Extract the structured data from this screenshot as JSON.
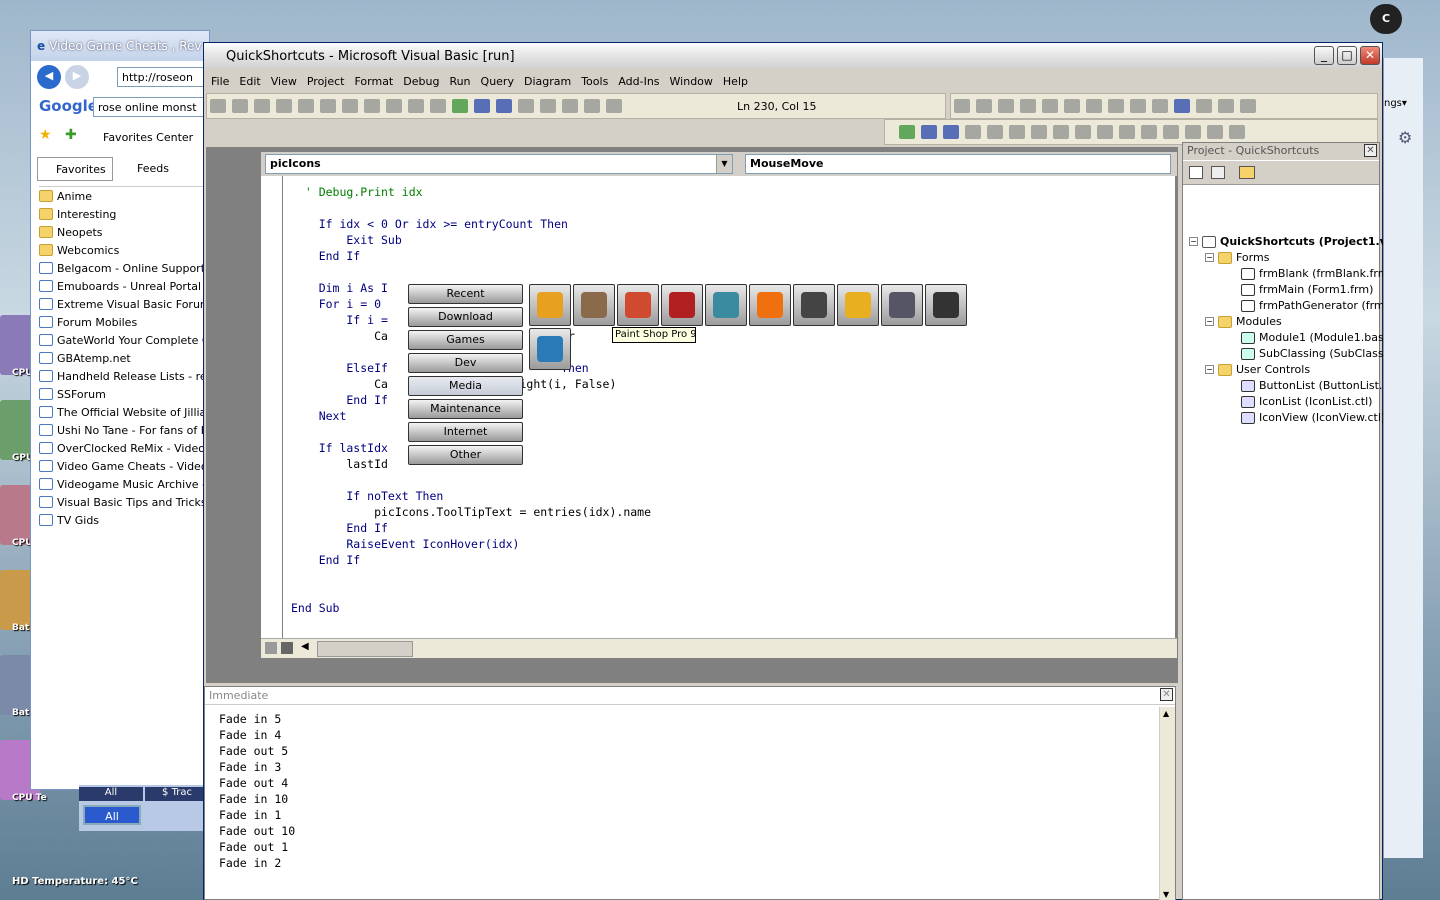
{
  "desktop": {
    "gadgets": [
      "CPU",
      "GPU",
      "CPU",
      "Bat",
      "Bat",
      "CPU Te"
    ],
    "hd_temperature": "HD Temperature: 45°C"
  },
  "ie": {
    "title": "Video Game Cheats , Rev",
    "address": "http://roseon",
    "google_search": "rose online monst",
    "favorites_center": "Favorites Center",
    "tab_favorites": "Favorites",
    "tab_feeds": "Feeds",
    "favorites": [
      {
        "label": "Anime",
        "type": "folder"
      },
      {
        "label": "Interesting",
        "type": "folder"
      },
      {
        "label": "Neopets",
        "type": "folder"
      },
      {
        "label": "Webcomics",
        "type": "folder"
      },
      {
        "label": "Belgacom - Online Support",
        "type": "page"
      },
      {
        "label": "Emuboards - Unreal Portal",
        "type": "page"
      },
      {
        "label": "Extreme Visual Basic Forum -",
        "type": "page"
      },
      {
        "label": "Forum Mobiles",
        "type": "page"
      },
      {
        "label": "GateWorld  Your Complete G",
        "type": "page"
      },
      {
        "label": "GBAtemp.net",
        "type": "page"
      },
      {
        "label": "Handheld Release Lists - rele",
        "type": "page"
      },
      {
        "label": "SSForum",
        "type": "page"
      },
      {
        "label": "The Official Website of Jillian",
        "type": "page"
      },
      {
        "label": "Ushi No Tane - For fans of H",
        "type": "page"
      },
      {
        "label": "OverClocked ReMix - Video G",
        "type": "page"
      },
      {
        "label": "Video Game Cheats - Video G",
        "type": "page"
      },
      {
        "label": "Videogame Music Archive - 1",
        "type": "page"
      },
      {
        "label": "Visual Basic Tips and Tricks",
        "type": "page"
      },
      {
        "label": "TV Gids",
        "type": "page"
      }
    ],
    "bottom_all_1": "All",
    "bottom_tab2": "$ Trac",
    "bottom_all_2": "All"
  },
  "vb": {
    "title": "QuickShortcuts - Microsoft Visual Basic [run]",
    "menus": [
      "File",
      "Edit",
      "View",
      "Project",
      "Format",
      "Debug",
      "Run",
      "Query",
      "Diagram",
      "Tools",
      "Add-Ins",
      "Window",
      "Help"
    ],
    "status": "Ln 230, Col 15",
    "object_combo": "picIcons",
    "proc_combo": "MouseMove",
    "code_lines": [
      {
        "t": "  ' Debug.Print idx",
        "c": "cm"
      },
      {
        "t": "",
        "c": ""
      },
      {
        "t": "    If idx < 0 Or idx >= entryCount Then",
        "c": "kw"
      },
      {
        "t": "        Exit Sub",
        "c": "kw"
      },
      {
        "t": "    End If",
        "c": "kw"
      },
      {
        "t": "",
        "c": ""
      },
      {
        "t": "    Dim i As I",
        "c": "kw"
      },
      {
        "t": "    For i = 0",
        "c": "kw"
      },
      {
        "t": "        If i =",
        "c": "kw"
      },
      {
        "t": "            Ca                     (i, Tr",
        "c": ""
      },
      {
        "t": "",
        "c": ""
      },
      {
        "t": "        ElseIf                         Then",
        "c": "kw"
      },
      {
        "t": "            Ca                  light(i, False)",
        "c": ""
      },
      {
        "t": "        End If",
        "c": "kw"
      },
      {
        "t": "    Next",
        "c": "kw"
      },
      {
        "t": "",
        "c": ""
      },
      {
        "t": "    If lastIdx",
        "c": "kw"
      },
      {
        "t": "        lastId",
        "c": ""
      },
      {
        "t": "",
        "c": ""
      },
      {
        "t": "        If noText Then",
        "c": "kw"
      },
      {
        "t": "            picIcons.ToolTipText = entries(idx).name",
        "c": ""
      },
      {
        "t": "        End If",
        "c": "kw"
      },
      {
        "t": "        RaiseEvent IconHover(idx)",
        "c": "kw"
      },
      {
        "t": "    End If",
        "c": "kw"
      },
      {
        "t": "",
        "c": ""
      },
      {
        "t": "",
        "c": ""
      },
      {
        "t": "End Sub",
        "c": "kw"
      }
    ],
    "immediate_title": "Immediate",
    "immediate_lines": [
      "Fade in 5",
      "Fade in 4",
      "Fade out 5",
      "Fade in 3",
      "Fade out 4",
      "Fade in 10",
      "Fade in 1",
      "Fade out 10",
      "Fade out 1",
      "Fade in 2"
    ],
    "project_title": "Project - QuickShortcuts",
    "tree": {
      "root": "QuickShortcuts (Project1.v",
      "forms_label": "Forms",
      "forms": [
        "frmBlank (frmBlank.frm)",
        "frmMain (Form1.frm)",
        "frmPathGenerator (frmF"
      ],
      "modules_label": "Modules",
      "modules": [
        "Module1 (Module1.bas)",
        "SubClassing (SubClassir"
      ],
      "usercontrols_label": "User Controls",
      "usercontrols": [
        "ButtonList (ButtonList.c",
        "IconList (IconList.ctl)",
        "IconView (IconView.ctl)"
      ]
    }
  },
  "launcher": {
    "categories": [
      "Recent",
      "Download",
      "Games",
      "Dev",
      "Media",
      "Maintenance",
      "Internet",
      "Other"
    ],
    "selected": "Media",
    "icon_names": [
      "audacity-icon",
      "media-app-icon",
      "paint-shop-pro-icon",
      "video-editor-icon",
      "media-player-icon",
      "vlc-icon",
      "video-converter-icon",
      "winamp-icon",
      "movie-maker-icon",
      "music-video-icon",
      "image-viewer-icon"
    ],
    "tooltip": "Paint Shop Pro 9"
  }
}
